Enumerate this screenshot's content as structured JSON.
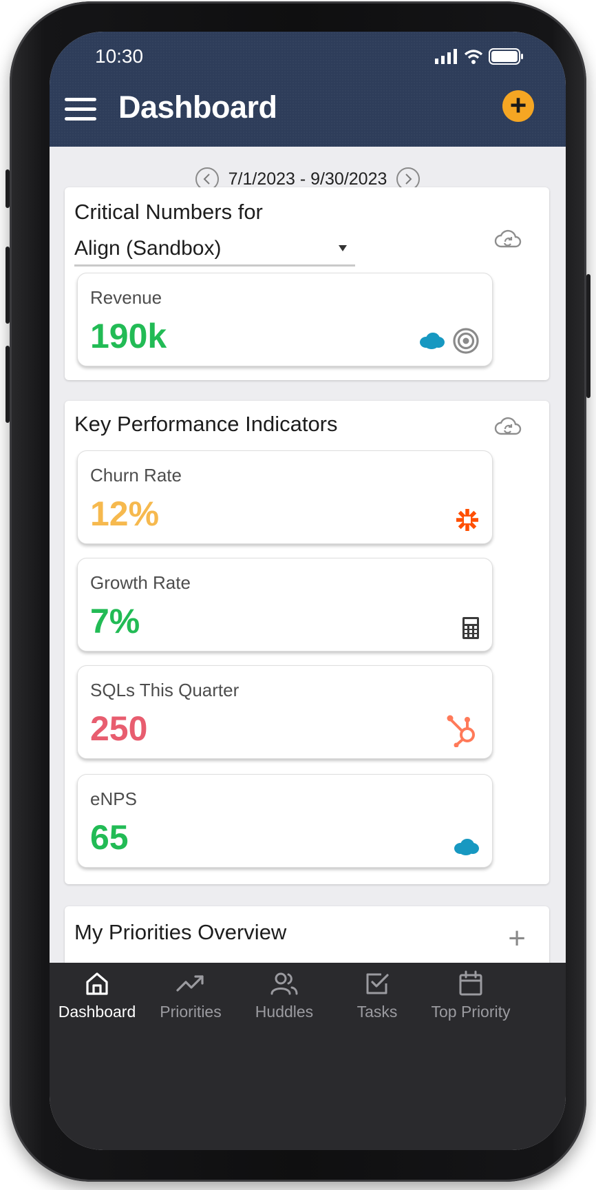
{
  "status": {
    "time": "10:30"
  },
  "header": {
    "title": "Dashboard"
  },
  "date_range": {
    "text": "7/1/2023 - 9/30/2023"
  },
  "critical": {
    "title": "Critical Numbers for",
    "selected_org": "Align (Sandbox)",
    "metric": {
      "label": "Revenue",
      "value": "190k",
      "color": "#22bb55"
    }
  },
  "kpi": {
    "title": "Key Performance Indicators",
    "items": [
      {
        "label": "Churn Rate",
        "value": "12%",
        "color": "#f6b94e",
        "icon": "zapier-icon"
      },
      {
        "label": "Growth Rate",
        "value": "7%",
        "color": "#22bb55",
        "icon": "calculator-icon"
      },
      {
        "label": "SQLs This Quarter",
        "value": "250",
        "color": "#e85d6f",
        "icon": "hubspot-icon"
      },
      {
        "label": "eNPS",
        "value": "65",
        "color": "#22bb55",
        "icon": "salesforce-icon"
      }
    ]
  },
  "priorities": {
    "title": "My Priorities Overview"
  },
  "tabs": [
    {
      "label": "Dashboard",
      "icon": "home-icon",
      "active": true
    },
    {
      "label": "Priorities",
      "icon": "trending-up-icon"
    },
    {
      "label": "Huddles",
      "icon": "users-icon"
    },
    {
      "label": "Tasks",
      "icon": "checkbox-icon"
    },
    {
      "label": "Top Priority",
      "icon": "calendar-icon"
    }
  ],
  "colors": {
    "header_bg": "#2e3d5a",
    "accent": "#f5a623",
    "tabbar_bg": "#2a2a2d"
  }
}
